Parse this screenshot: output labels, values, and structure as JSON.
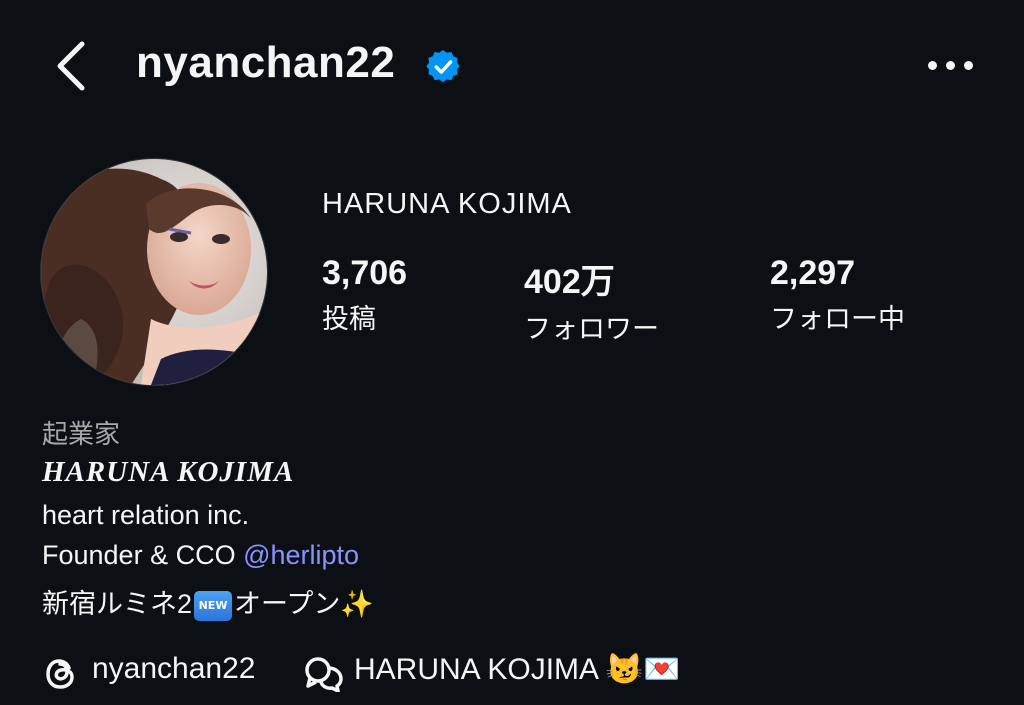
{
  "header": {
    "username": "nyanchan22",
    "back_icon": "chevron-left-icon",
    "verified_icon": "verified-badge-icon",
    "more_icon": "more-horizontal-icon"
  },
  "profile": {
    "display_name": "HARUNA KOJIMA",
    "stats": [
      {
        "value": "3,706",
        "label": "投稿"
      },
      {
        "value": "402万",
        "label": "フォロワー"
      },
      {
        "value": "2,297",
        "label": "フォロー中"
      }
    ]
  },
  "bio": {
    "category": "起業家",
    "name": "HARUNA KOJIMA",
    "line1": "heart relation inc.",
    "line2_prefix": "Founder & CCO ",
    "line2_mention": "@herlipto",
    "line3_prefix": "新宿ルミネ2",
    "line3_badge": "NEW",
    "line3_suffix": "オープン",
    "line3_emoji": "✨"
  },
  "links": {
    "threads_handle": "nyanchan22",
    "threads_icon": "threads-icon",
    "facebook_name": "HARUNA KOJIMA",
    "facebook_icon": "facebook-messenger-icon",
    "emojis": "😼💌"
  },
  "colors": {
    "background": "#0c1014",
    "text": "#f5f5f5",
    "muted": "#a8a8a8",
    "mention": "#8b92ff",
    "verified": "#0095f6"
  }
}
